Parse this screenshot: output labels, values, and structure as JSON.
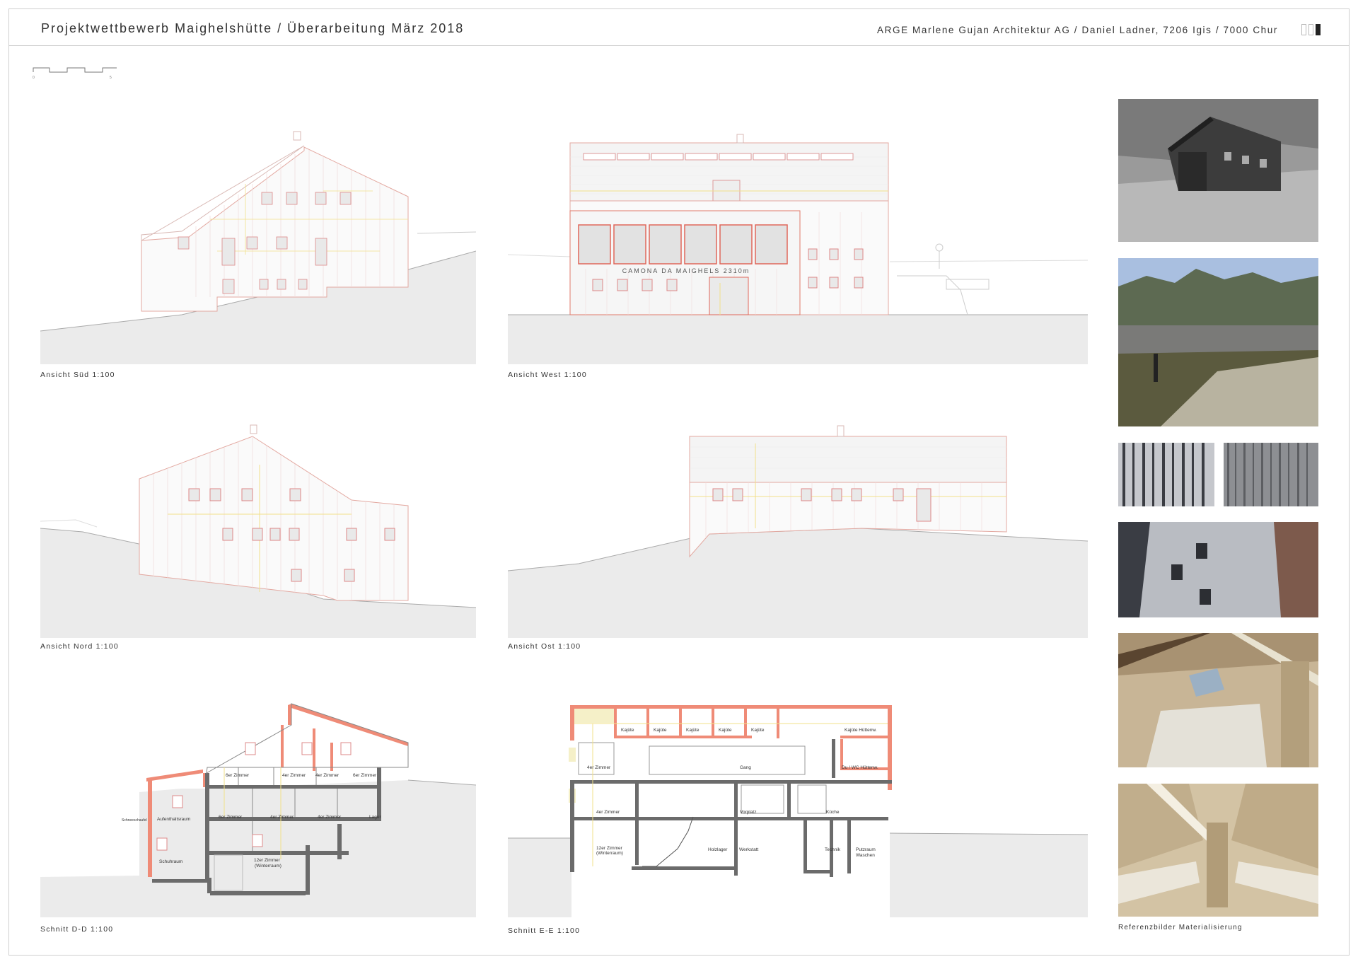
{
  "header": {
    "title": "Projektwettbewerb Maighelshütte / Überarbeitung März 2018",
    "authors": "ARGE Marlene Gujan Architektur AG / Daniel Ladner, 7206 Igis / 7000 Chur"
  },
  "drawings": {
    "sued": {
      "caption": "Ansicht Süd 1:100"
    },
    "west": {
      "caption": "Ansicht West 1:100",
      "sign": "CAMONA DA MAIGHELS 2310m"
    },
    "nord": {
      "caption": "Ansicht Nord 1:100"
    },
    "ost": {
      "caption": "Ansicht Ost 1:100"
    },
    "schnitt_dd": {
      "caption": "Schnitt D-D 1:100",
      "rooms": {
        "r1": "6er Zimmer",
        "r2": "4er Zimmer",
        "r3": "4er Zimmer",
        "r4": "6er Zimmer",
        "r5": "Aufenthaltsraum",
        "r6": "6er Zimmer",
        "r7": "4er Zimmer",
        "r8": "4er Zimmer",
        "r9": "Lager",
        "r10": "Schuhraum",
        "r11": "12er Zimmer",
        "r11b": "(Winterraum)",
        "r12": "Schneeschaufel"
      }
    },
    "schnitt_ee": {
      "caption": "Schnitt E-E 1:100",
      "rooms": {
        "k1": "Kajüte",
        "k2": "Kajüte",
        "k3": "Kajüte",
        "k4": "Kajüte",
        "k5": "Kajüte",
        "k6": "Kajüte Hüttenw.",
        "z1": "4er Zimmer",
        "gang": "Gang",
        "du": "Du / WC Hüttenw.",
        "z2": "4er Zimmer",
        "vorplatz": "Vorplatz",
        "kueche": "Küche",
        "z3": "12er Zimmer",
        "z3b": "(Winterraum)",
        "holz": "Holzlager",
        "werk": "Werkstatt",
        "technik": "Technik",
        "putz": "Putzraum",
        "putzb": "Waschen"
      }
    }
  },
  "references": {
    "caption": "Referenzbilder Materialisierung"
  }
}
